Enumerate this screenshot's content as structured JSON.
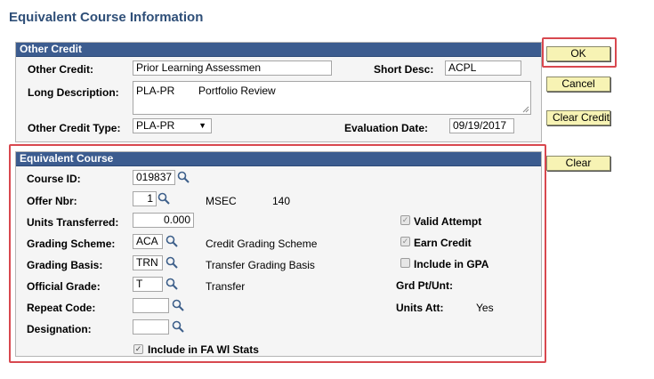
{
  "page_title": "Equivalent Course Information",
  "other_credit": {
    "header": "Other Credit",
    "other_credit_label": "Other Credit:",
    "other_credit_value": "Prior Learning Assessmen",
    "short_desc_label": "Short Desc:",
    "short_desc_value": "ACPL",
    "long_desc_label": "Long Description:",
    "long_desc_value": "PLA-PR        Portfolio Review",
    "type_label": "Other Credit Type:",
    "type_value": "PLA-PR",
    "eval_date_label": "Evaluation Date:",
    "eval_date_value": "09/19/2017"
  },
  "equivalent_course": {
    "header": "Equivalent Course",
    "course_id_label": "Course ID:",
    "course_id_value": "019837",
    "offer_nbr_label": "Offer Nbr:",
    "offer_nbr_value": "1",
    "campus_code": "MSEC",
    "campus_number": "140",
    "units_label": "Units Transferred:",
    "units_value": "0.000",
    "grading_scheme_label": "Grading Scheme:",
    "grading_scheme_value": "ACA",
    "grading_scheme_desc": "Credit Grading Scheme",
    "grading_basis_label": "Grading Basis:",
    "grading_basis_value": "TRN",
    "grading_basis_desc": "Transfer Grading Basis",
    "official_grade_label": "Official Grade:",
    "official_grade_value": "T",
    "official_grade_desc": "Transfer",
    "repeat_code_label": "Repeat Code:",
    "repeat_code_value": "",
    "designation_label": "Designation:",
    "designation_value": "",
    "valid_attempt_label": "Valid Attempt",
    "earn_credit_label": "Earn Credit",
    "include_gpa_label": "Include in GPA",
    "grd_pt_label": "Grd Pt/Unt:",
    "units_att_label": "Units Att:",
    "units_att_value": "Yes",
    "fa_stats_label": "Include in FA Wl Stats"
  },
  "buttons": {
    "ok": "OK",
    "cancel": "Cancel",
    "clear_credit": "Clear Credit",
    "clear": "Clear"
  },
  "checkbox_states": {
    "valid_attempt": true,
    "earn_credit": true,
    "include_gpa": false,
    "fa_stats": true
  },
  "colors": {
    "section_header": "#3c5c8f",
    "title": "#2f4f78",
    "button": "#f7f3b4",
    "highlight": "#d8484f"
  }
}
